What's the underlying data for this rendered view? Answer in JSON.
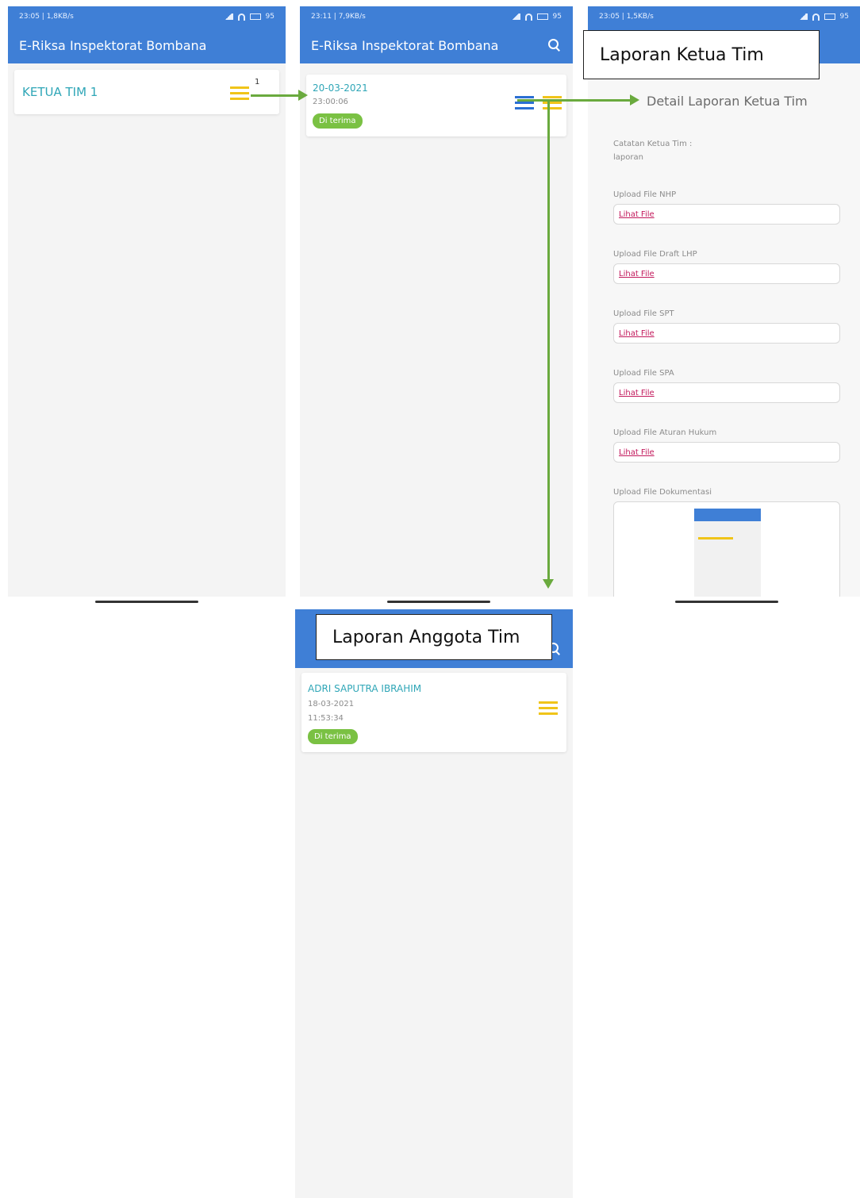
{
  "status": {
    "time_left": "23:05 | 1,8KB/s",
    "time_mid": "23:11 | 7,9KB/s",
    "time_right": "23:05 | 1,5KB/s",
    "battery": "95"
  },
  "app": {
    "title": "E-Riksa Inspektorat Bombana"
  },
  "screen1": {
    "team_name": "KETUA TIM 1",
    "count": "1"
  },
  "screen2": {
    "date": "20-03-2021",
    "time": "23:00:06",
    "status": "Di terima"
  },
  "screen3": {
    "header": "Detail Laporan Ketua Tim",
    "note_label": "Catatan Ketua Tim :",
    "note_value": "laporan",
    "fields": [
      {
        "label": "Upload File NHP",
        "link": "Lihat File"
      },
      {
        "label": "Upload File Draft LHP",
        "link": "Lihat File"
      },
      {
        "label": "Upload File SPT",
        "link": "Lihat File"
      },
      {
        "label": "Upload File SPA",
        "link": "Lihat File"
      },
      {
        "label": "Upload File Aturan Hukum",
        "link": "Lihat File"
      }
    ],
    "doc_label": "Upload File Dokumentasi"
  },
  "screen4": {
    "member_name": "ADRI SAPUTRA IBRAHIM",
    "date": "18-03-2021",
    "time": "11:53:34",
    "status": "Di terima"
  },
  "callouts": {
    "ketua": "Laporan Ketua Tim",
    "anggota": "Laporan Anggota Tim"
  },
  "colors": {
    "primary": "#3f7fd6",
    "accent_teal": "#2fa6b7",
    "badge_green": "#7ac143",
    "arrow_green": "#6aaa3e",
    "icon_yellow": "#f0c419",
    "link_pink": "#c2185b"
  }
}
